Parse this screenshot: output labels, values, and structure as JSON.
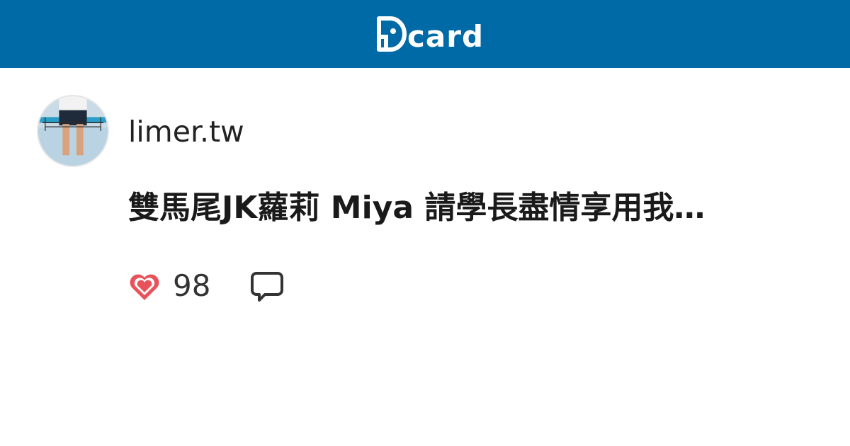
{
  "brand": {
    "name": "Dcard",
    "logo_text": "card",
    "header_color": "#006aa6"
  },
  "post": {
    "author": "limer.tw",
    "title": "雙馬尾JK蘿莉 Miya 請學長盡情享用我…",
    "likes": "98"
  },
  "icons": {
    "like": "heart-icon",
    "comment": "comment-bubble-icon"
  },
  "colors": {
    "heart": "#e8535b",
    "text": "#222222",
    "icon_stroke": "#333333"
  }
}
